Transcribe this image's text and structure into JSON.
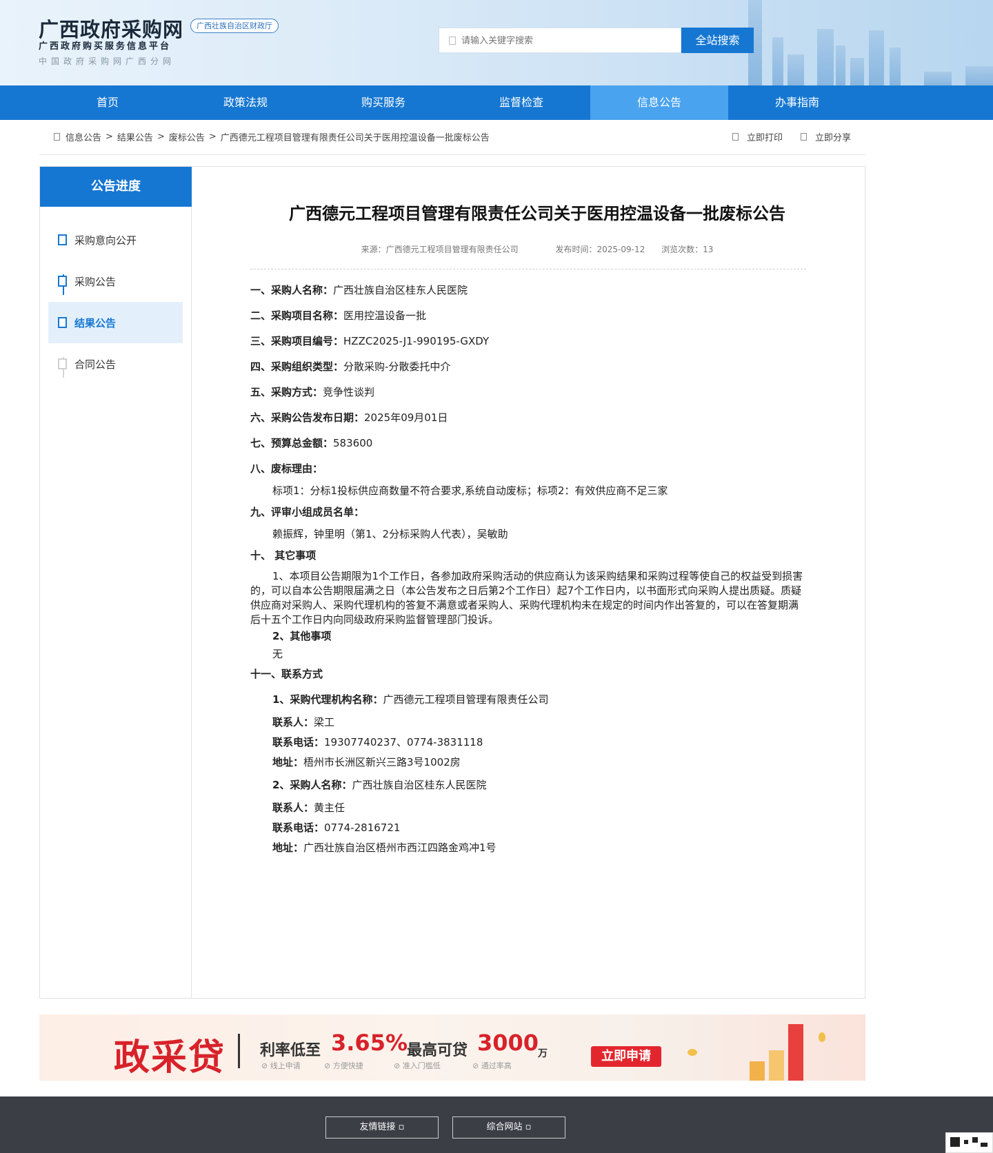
{
  "header": {
    "title": "广西政府采购网",
    "badge": "广西壮族自治区财政厅",
    "subtitle": "广西政府购买服务信息平台",
    "subtitle2": "中国政府采购网广西分网",
    "search_placeholder": "请输入关键字搜索",
    "search_button": "全站搜索"
  },
  "nav": {
    "items": [
      {
        "label": "首页"
      },
      {
        "label": "政策法规"
      },
      {
        "label": "购买服务"
      },
      {
        "label": "监督检查"
      },
      {
        "label": "信息公告"
      },
      {
        "label": "办事指南"
      }
    ],
    "active_index": 4
  },
  "breadcrumb": {
    "items": [
      "信息公告",
      "结果公告",
      "废标公告",
      "广西德元工程项目管理有限责任公司关于医用控温设备一批废标公告"
    ],
    "separator": ">",
    "print": "立即打印",
    "share": "立即分享"
  },
  "sidebar": {
    "title": "公告进度",
    "steps": [
      {
        "label": "采购意向公开"
      },
      {
        "label": "采购公告"
      },
      {
        "label": "结果公告"
      },
      {
        "label": "合同公告"
      }
    ]
  },
  "article": {
    "title": "广西德元工程项目管理有限责任公司关于医用控温设备一批废标公告",
    "source": "来源：广西德元工程项目管理有限责任公司",
    "publish_time": "发布时间：2025-09-12",
    "views": "浏览次数：13",
    "s1_label": "一、采购人名称：",
    "s1_value": "广西壮族自治区桂东人民医院",
    "s2_label": "二、采购项目名称：",
    "s2_value": "医用控温设备一批",
    "s3_label": "三、采购项目编号：",
    "s3_value": "HZZC2025-J1-990195-GXDY",
    "s4_label": "四、采购组织类型：",
    "s4_value": "分散采购-分散委托中介",
    "s5_label": "五、采购方式：",
    "s5_value": "竞争性谈判",
    "s6_label": "六、采购公告发布日期：",
    "s6_value": "2025年09月01日",
    "s7_label": "七、预算总金额：",
    "s7_value": "583600",
    "s8_label": "八、废标理由：",
    "s8_value": "标项1：分标1投标供应商数量不符合要求,系统自动废标；标项2：有效供应商不足三家",
    "s9_label": "九、评审小组成员名单：",
    "s9_value": "赖振辉，钟里明（第1、2分标采购人代表），吴敏助",
    "s10_label": "十、 其它事项",
    "s10_para": "1、本项目公告期限为1个工作日，各参加政府采购活动的供应商认为该采购结果和采购过程等使自己的权益受到损害的，可以自本公告期限届满之日（本公告发布之日后第2个工作日）起7个工作日内，以书面形式向采购人提出质疑。质疑供应商对采购人、采购代理机构的答复不满意或者采购人、采购代理机构未在规定的时间内作出答复的，可以在答复期满后十五个工作日内向同级政府采购监督管理部门投诉。",
    "s10_sub_label": "2、其他事项",
    "s10_sub_value": "无",
    "s11_label": "十一、联系方式",
    "c1_label": "1、采购代理机构名称：",
    "c1_value": "广西德元工程项目管理有限责任公司",
    "c1_contact_label": "联系人：",
    "c1_contact": "梁工",
    "c1_phone_label": "联系电话：",
    "c1_phone": "19307740237、0774-3831118",
    "c1_addr_label": "地址：",
    "c1_addr": "梧州市长洲区新兴三路3号1002房",
    "c2_label": "2、采购人名称：",
    "c2_value": "广西壮族自治区桂东人民医院",
    "c2_contact_label": "联系人：",
    "c2_contact": "黄主任",
    "c2_phone_label": "联系电话：",
    "c2_phone": "0774-2816721",
    "c2_addr_label": "地址：",
    "c2_addr": "广西壮族自治区梧州市西江四路金鸡冲1号"
  },
  "banner": {
    "title": "政采贷",
    "rate_label": "利率低至",
    "rate_value": "3.65%",
    "loan_label": "最高可贷",
    "loan_value": "3000",
    "loan_unit": "万",
    "features": [
      "线上申请",
      "方便快捷",
      "准入门槛低",
      "通过率高"
    ],
    "apply_button": "立即申请"
  },
  "footer": {
    "links_button": "友情链接 ▫",
    "sites_button": "综合网站 ▫"
  },
  "colors": {
    "primary": "#1677d2",
    "nav_active": "#4aa3ee",
    "banner_red": "#d8222a",
    "footer_bg": "#3b3e45"
  }
}
